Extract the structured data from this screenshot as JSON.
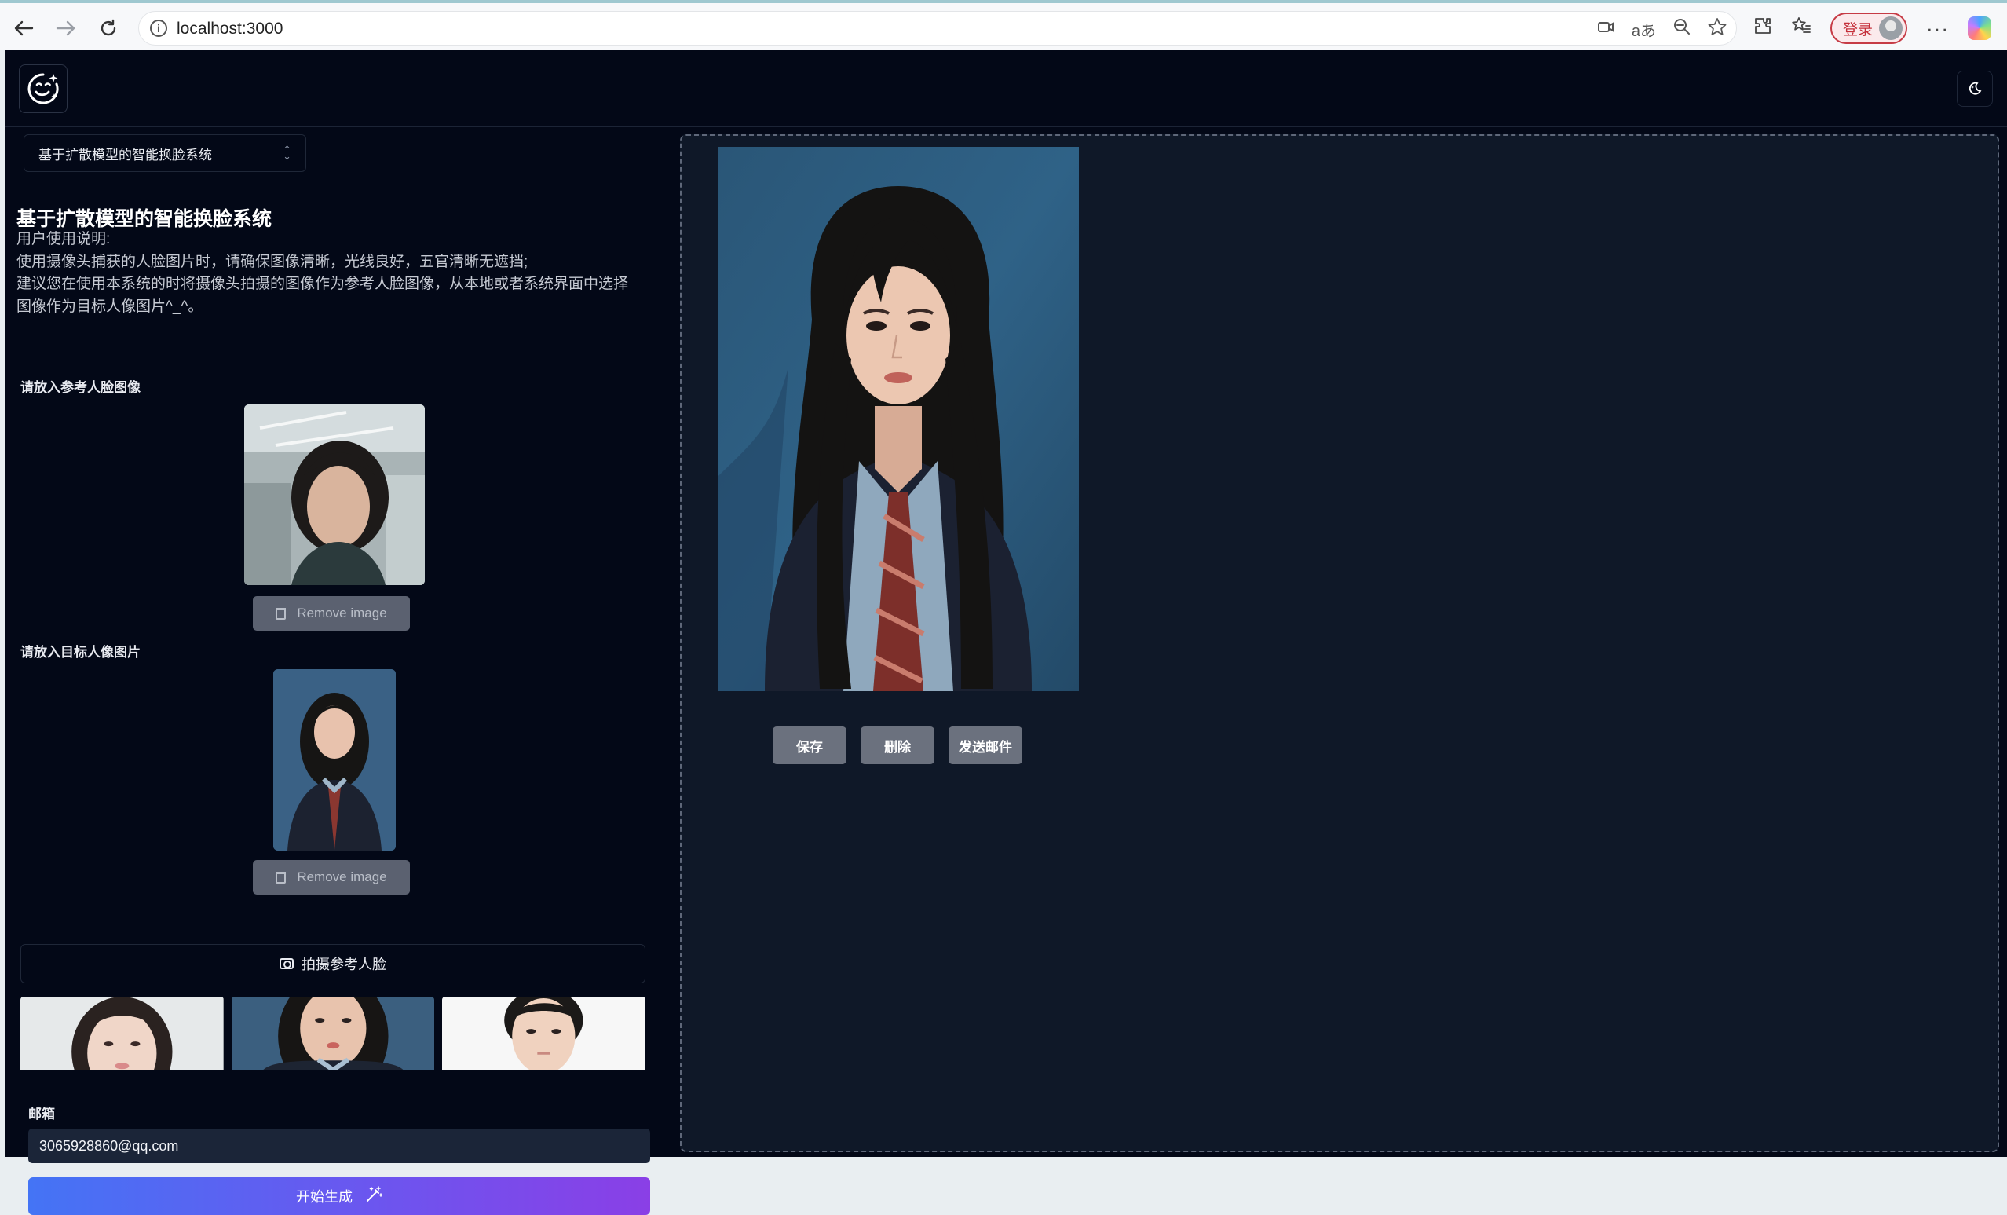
{
  "browser": {
    "url": "localhost:3000",
    "login_label": "登录",
    "back_icon": "arrow-left-icon",
    "forward_icon": "arrow-right-icon",
    "reload_icon": "reload-icon"
  },
  "header": {
    "logo_icon": "face-sparkle-icon",
    "theme_icon": "moon-icon"
  },
  "left": {
    "model_select": "基于扩散模型的智能换脸系统",
    "title": "基于扩散模型的智能换脸系统",
    "instructions": [
      "用户使用说明:",
      "使用摄像头捕获的人脸图片时，请确保图像清晰，光线良好，五官清晰无遮挡;",
      "建议您在使用本系统的时将摄像头拍摄的图像作为参考人脸图像，从本地或者系统界面中选择",
      "图像作为目标人像图片^_^。"
    ],
    "reference_label": "请放入参考人脸图像",
    "target_label": "请放入目标人像图片",
    "remove_label": "Remove image",
    "capture_label": "拍摄参考人脸",
    "email_label": "邮箱",
    "email_value": "3065928860@qq.com",
    "generate_label": "开始生成"
  },
  "right": {
    "save_label": "保存",
    "delete_label": "删除",
    "send_label": "发送邮件"
  },
  "colors": {
    "app_bg": "#030817",
    "panel_bg": "#0f1828",
    "gradient_start": "#4474f5",
    "gradient_end": "#8a3fe6",
    "login_accent": "#c63b45"
  }
}
